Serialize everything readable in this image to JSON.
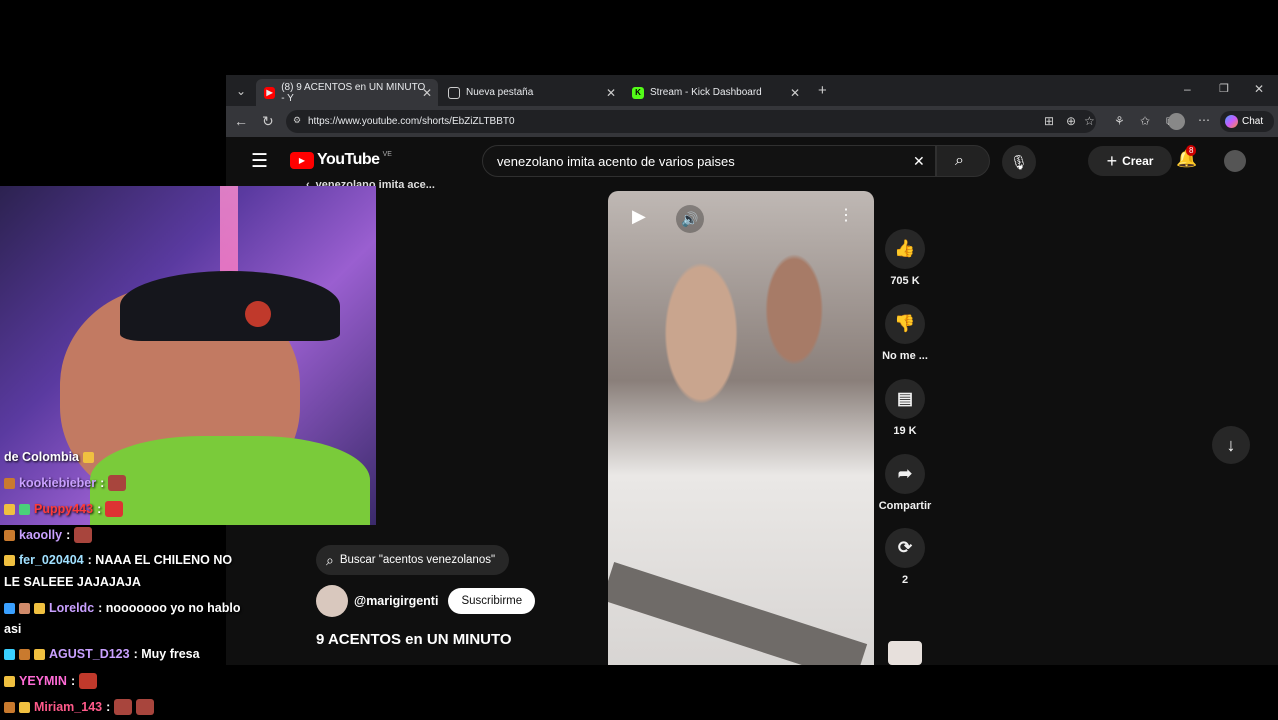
{
  "browser": {
    "tabs": [
      {
        "label": "(8) 9 ACENTOS en UN MINUTO - Y",
        "favicon": "youtube-icon",
        "active": true
      },
      {
        "label": "Nueva pestaña",
        "favicon": "page-icon",
        "active": false
      },
      {
        "label": "Stream - Kick Dashboard",
        "favicon": "kick-icon",
        "active": false
      }
    ],
    "url": "https://www.youtube.com/shorts/EbZiZLTBBT0",
    "chat_label": "Chat"
  },
  "youtube": {
    "logo_text": "YouTube",
    "country_code": "VE",
    "search_value": "venezolano imita acento de varios paises",
    "create_label": "Crear",
    "notification_count": "8",
    "back_query": "venezolano imita ace...",
    "related_search": "Buscar \"acentos venezolanos\"",
    "channel": "@marigirgenti",
    "subscribe_label": "Suscribirme",
    "video_title": "9 ACENTOS en UN MINUTO",
    "actions": {
      "likes": "705 K",
      "dislike_label": "No me ...",
      "comments": "19 K",
      "share_label": "Compartir",
      "remix_count": "2"
    }
  },
  "chat": [
    {
      "user": "",
      "message": "de Colombia",
      "color": "#ffffff"
    },
    {
      "user": "kookiebieber",
      "message": ":",
      "color": "#c9a0ff"
    },
    {
      "user": "Puppy443",
      "message": ":",
      "color": "#ff3b3b"
    },
    {
      "user": "kaoolly",
      "message": ":",
      "color": "#c9a0ff"
    },
    {
      "user": "fer_020404",
      "message": ": NAAA EL CHILENO NO",
      "color": "#a0e0ff"
    },
    {
      "user": "",
      "message": "LE SALEEE JAJAJAJA",
      "color": "#ffffff"
    },
    {
      "user": "Loreldc",
      "message": ": nooooooo yo no hablo",
      "color": "#c9a0ff"
    },
    {
      "user": "",
      "message": "asi",
      "color": "#ffffff"
    },
    {
      "user": "AGUST_D123",
      "message": ": Muy fresa",
      "color": "#c9a0ff"
    },
    {
      "user": "YEYMIN",
      "message": ":",
      "color": "#ff6bd6"
    },
    {
      "user": "Miriam_143",
      "message": ":",
      "color": "#ff5a8a"
    }
  ],
  "colors": {
    "youtube_red": "#ff0000",
    "kick_green": "#53fc18",
    "yt_bg": "#0f0f0f"
  }
}
